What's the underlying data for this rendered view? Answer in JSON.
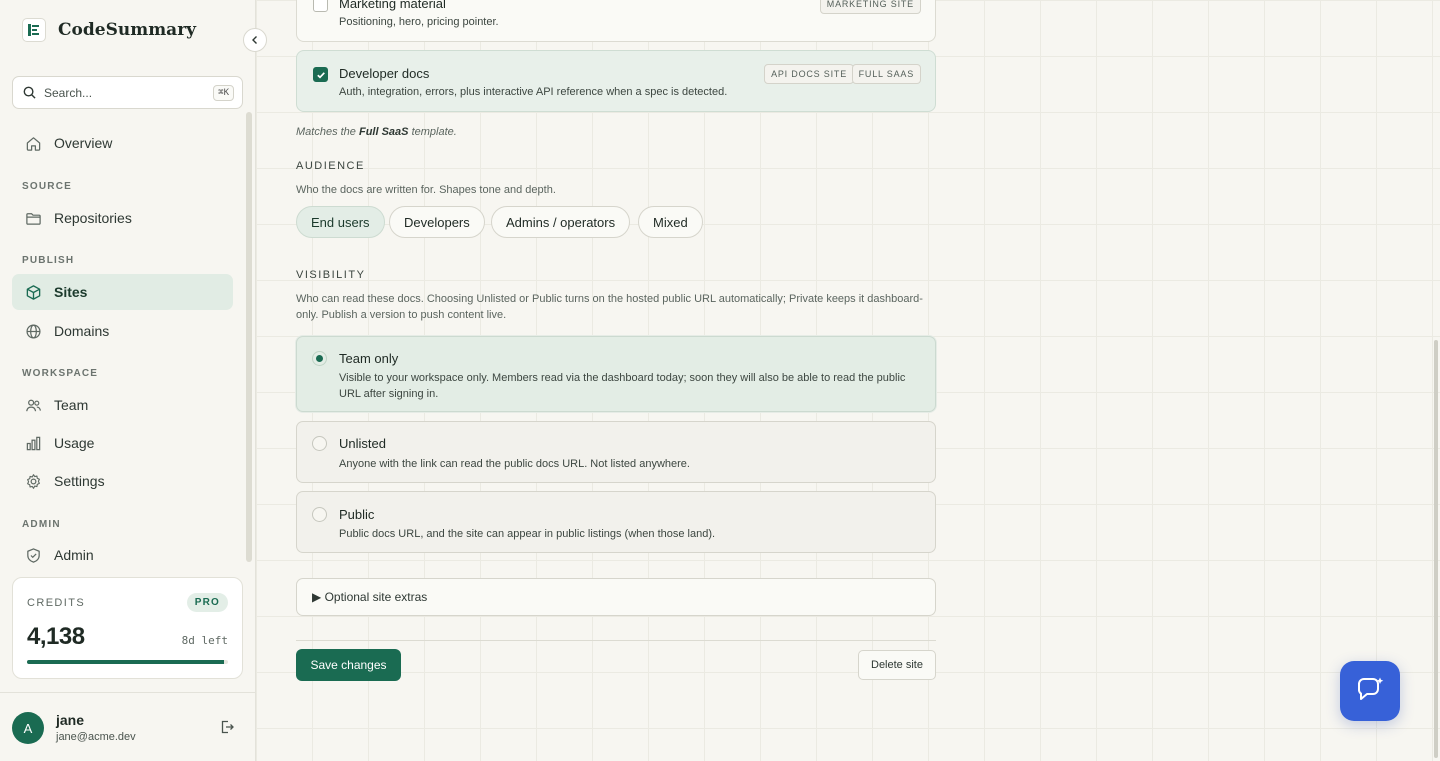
{
  "app": {
    "name": "CodeSummary"
  },
  "search": {
    "placeholder": "Search...",
    "shortcut": "⌘K"
  },
  "sidebar": {
    "items": [
      {
        "label": "Overview",
        "icon": "home-icon"
      },
      {
        "section": "SOURCE"
      },
      {
        "label": "Repositories",
        "icon": "folder-icon"
      },
      {
        "section": "PUBLISH"
      },
      {
        "label": "Sites",
        "icon": "cube-icon",
        "active": true
      },
      {
        "label": "Domains",
        "icon": "globe-icon"
      },
      {
        "section": "WORKSPACE"
      },
      {
        "label": "Team",
        "icon": "users-icon"
      },
      {
        "label": "Usage",
        "icon": "bar-chart-icon"
      },
      {
        "label": "Settings",
        "icon": "gear-icon"
      },
      {
        "section": "ADMIN"
      },
      {
        "label": "Admin",
        "icon": "shield-icon"
      }
    ],
    "labels": {
      "overview": "Overview",
      "source": "SOURCE",
      "repositories": "Repositories",
      "publish": "PUBLISH",
      "sites": "Sites",
      "domains": "Domains",
      "workspace": "WORKSPACE",
      "team": "Team",
      "usage": "Usage",
      "settings": "Settings",
      "admin_section": "ADMIN",
      "admin": "Admin"
    }
  },
  "credits": {
    "label": "CREDITS",
    "plan": "PRO",
    "value": "4,138",
    "time_left": "8d left",
    "remaining_fraction": 0.98
  },
  "user": {
    "initial": "A",
    "name": "jane",
    "email": "jane@acme.dev"
  },
  "content": {
    "purposes": [
      {
        "title": "Marketing material",
        "desc": "Positioning, hero, pricing pointer.",
        "checked": false,
        "tags": [
          "MARKETING SITE"
        ]
      },
      {
        "title": "Developer docs",
        "desc": "Auth, integration, errors, plus interactive API reference when a spec is detected.",
        "checked": true,
        "tags": [
          "API DOCS SITE",
          "FULL SAAS"
        ]
      }
    ],
    "template_note": {
      "prefix": "Matches the",
      "template": "Full SaaS",
      "suffix": "template."
    },
    "audience": {
      "heading": "AUDIENCE",
      "sub": "Who the docs are written for. Shapes tone and depth.",
      "options": [
        "End users",
        "Developers",
        "Admins / operators",
        "Mixed"
      ],
      "selected": "End users"
    },
    "visibility": {
      "heading": "VISIBILITY",
      "sub": "Who can read these docs. Choosing Unlisted or Public turns on the hosted public URL automatically; Private keeps it dashboard-only. Publish a version to push content live.",
      "options": [
        {
          "title": "Team only",
          "desc": "Visible to your workspace only. Members read via the dashboard today; soon they will also be able to read the public URL after signing in.",
          "selected": true
        },
        {
          "title": "Unlisted",
          "desc": "Anyone with the link can read the public docs URL. Not listed anywhere.",
          "selected": false
        },
        {
          "title": "Public",
          "desc": "Public docs URL, and the site can appear in public listings (when those land).",
          "selected": false
        }
      ]
    },
    "extras_label": "▶ Optional site extras",
    "save_label": "Save changes",
    "delete_label": "Delete site"
  },
  "colors": {
    "accent": "#1a6b52",
    "chat": "#3761d8",
    "background": "#f7f6f1"
  }
}
